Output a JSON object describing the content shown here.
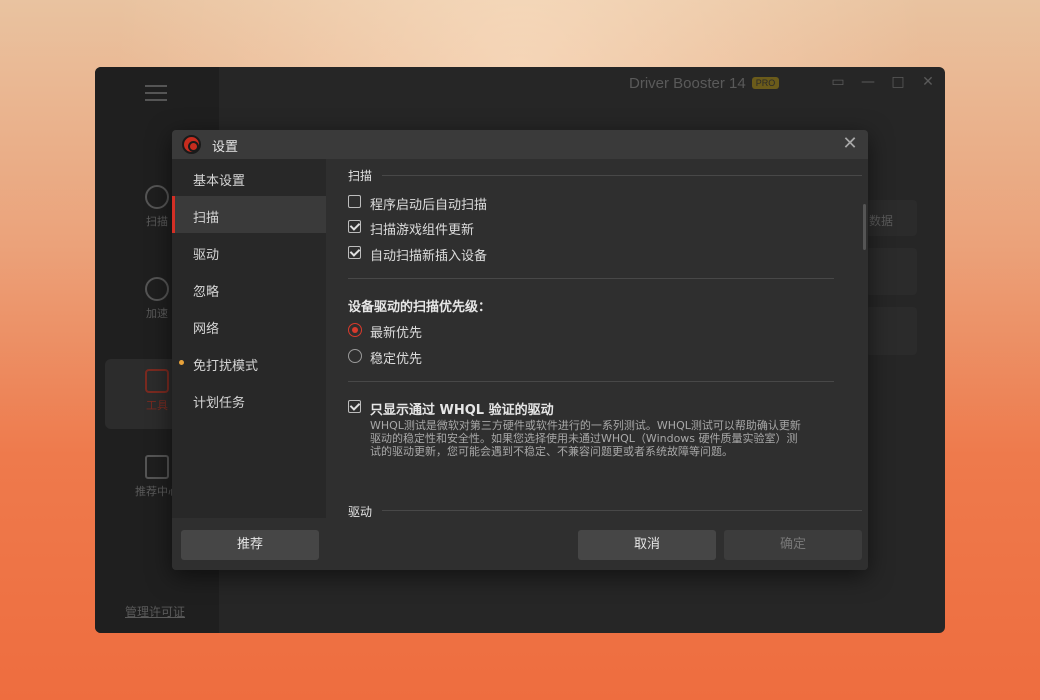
{
  "app": {
    "title": "Driver Booster 14",
    "pro_badge": "PRO",
    "license_link": "管理许可证",
    "nav": [
      {
        "label": "扫描"
      },
      {
        "label": "加速"
      },
      {
        "label": "工具"
      },
      {
        "label": "推荐中心"
      }
    ],
    "right_card_text": "数据"
  },
  "dialog": {
    "title": "设置",
    "sidebar": [
      {
        "label": "基本设置"
      },
      {
        "label": "扫描"
      },
      {
        "label": "驱动"
      },
      {
        "label": "忽略"
      },
      {
        "label": "网络"
      },
      {
        "label": "免打扰模式"
      },
      {
        "label": "计划任务"
      }
    ],
    "scan_section": {
      "title": "扫描",
      "options": [
        {
          "label": "程序启动后自动扫描",
          "checked": false
        },
        {
          "label": "扫描游戏组件更新",
          "checked": true
        },
        {
          "label": "自动扫描新插入设备",
          "checked": true
        }
      ]
    },
    "priority": {
      "title": "设备驱动的扫描优先级：",
      "options": [
        {
          "label": "最新优先",
          "selected": true
        },
        {
          "label": "稳定优先",
          "selected": false
        }
      ]
    },
    "whql": {
      "label": "只显示通过 WHQL 验证的驱动",
      "checked": true,
      "desc_line1": "WHQL测试是微软对第三方硬件或软件进行的一系列测试。WHQL测试可以帮助确认更新",
      "desc_line2": "驱动的稳定性和安全性。如果您选择使用未通过WHQL（Windows 硬件质量实验室）测",
      "desc_line3": "试的驱动更新，您可能会遇到不稳定、不兼容问题更或者系统故障等问题。"
    },
    "driver_section": {
      "title": "驱动"
    },
    "buttons": {
      "recommend": "推荐",
      "cancel": "取消",
      "ok": "确定"
    }
  },
  "colors": {
    "accent_red": "#d83a2c",
    "dnd_dot": "#e8a23a"
  }
}
